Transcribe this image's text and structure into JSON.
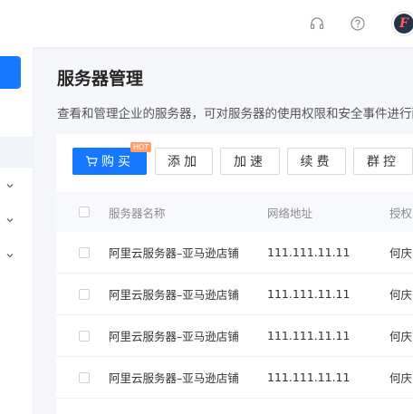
{
  "header": {
    "support_icon": "headset-icon",
    "help_icon": "question-circle-icon",
    "avatar_letter": "F"
  },
  "sidebar": {
    "chevron_icon": "chevron-down-icon"
  },
  "page": {
    "title": "服务器管理",
    "description": "查看和管理企业的服务器，可对服务器的使用权限和安全事件进行配置"
  },
  "toolbar": {
    "buy_label": "购买",
    "buy_badge": "HOT",
    "add_label": "添加",
    "speed_label": "加速",
    "renew_label": "续费",
    "group_label": "群控"
  },
  "table": {
    "columns": [
      "服务器名称",
      "网络地址",
      "授权人"
    ],
    "rows": [
      {
        "name": "阿里云服务器–亚马逊店铺",
        "ip": "111.111.11.11",
        "owner": "何庆"
      },
      {
        "name": "阿里云服务器–亚马逊店铺",
        "ip": "111.111.11.11",
        "owner": "何庆"
      },
      {
        "name": "阿里云服务器–亚马逊店铺",
        "ip": "111.111.11.11",
        "owner": "何庆"
      },
      {
        "name": "阿里云服务器–亚马逊店铺",
        "ip": "111.111.11.11",
        "owner": "何庆"
      }
    ]
  },
  "colors": {
    "primary": "#1677ff",
    "badge": "#ff9d6b",
    "content_bg": "#f5f7fa"
  }
}
